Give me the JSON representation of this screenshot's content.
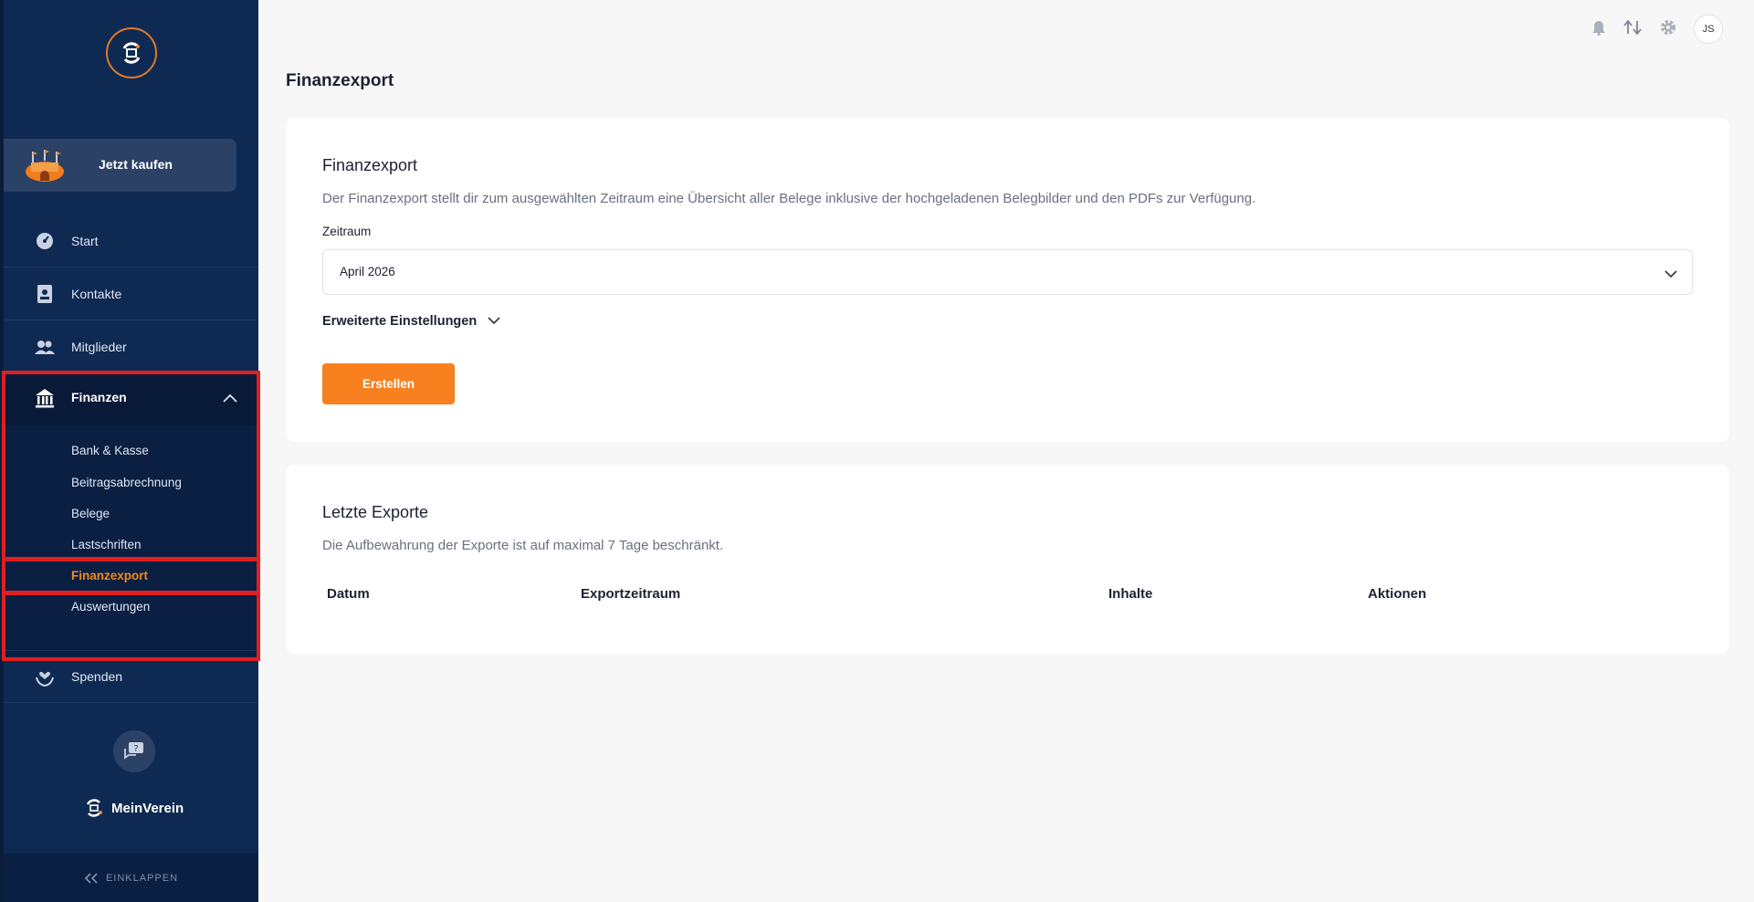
{
  "sidebar": {
    "buy_label": "Jetzt kaufen",
    "nav": [
      {
        "label": "Start",
        "icon": "dashboard-icon"
      },
      {
        "label": "Kontakte",
        "icon": "contact-card-icon"
      },
      {
        "label": "Mitglieder",
        "icon": "members-icon"
      }
    ],
    "finanzen": {
      "label": "Finanzen",
      "icon": "bank-icon",
      "subitems": [
        "Bank & Kasse",
        "Beitragsabrechnung",
        "Belege",
        "Lastschriften",
        "Finanzexport",
        "Auswertungen"
      ],
      "active": "Finanzexport"
    },
    "spenden_label": "Spenden",
    "brand": "MeinVerein",
    "collapse_label": "EINKLAPPEN"
  },
  "topbar": {
    "avatar_initials": "JS"
  },
  "page": {
    "title": "Finanzexport"
  },
  "export_card": {
    "title": "Finanzexport",
    "description": "Der Finanzexport stellt dir zum ausgewählten Zeitraum eine Übersicht aller Belege inklusive der hochgeladenen Belegbilder und den PDFs zur Verfügung.",
    "period_label": "Zeitraum",
    "period_value": "April 2026",
    "advanced_label": "Erweiterte Einstellungen",
    "create_button": "Erstellen"
  },
  "recent_card": {
    "title": "Letzte Exporte",
    "description": "Die Aufbewahrung der Exporte ist auf maximal 7 Tage beschränkt.",
    "columns": [
      "Datum",
      "Exportzeitraum",
      "Inhalte",
      "Aktionen"
    ]
  },
  "colors": {
    "sidebar_bg": "#0f2a52",
    "accent": "#f9801e",
    "highlight": "#e02020"
  }
}
